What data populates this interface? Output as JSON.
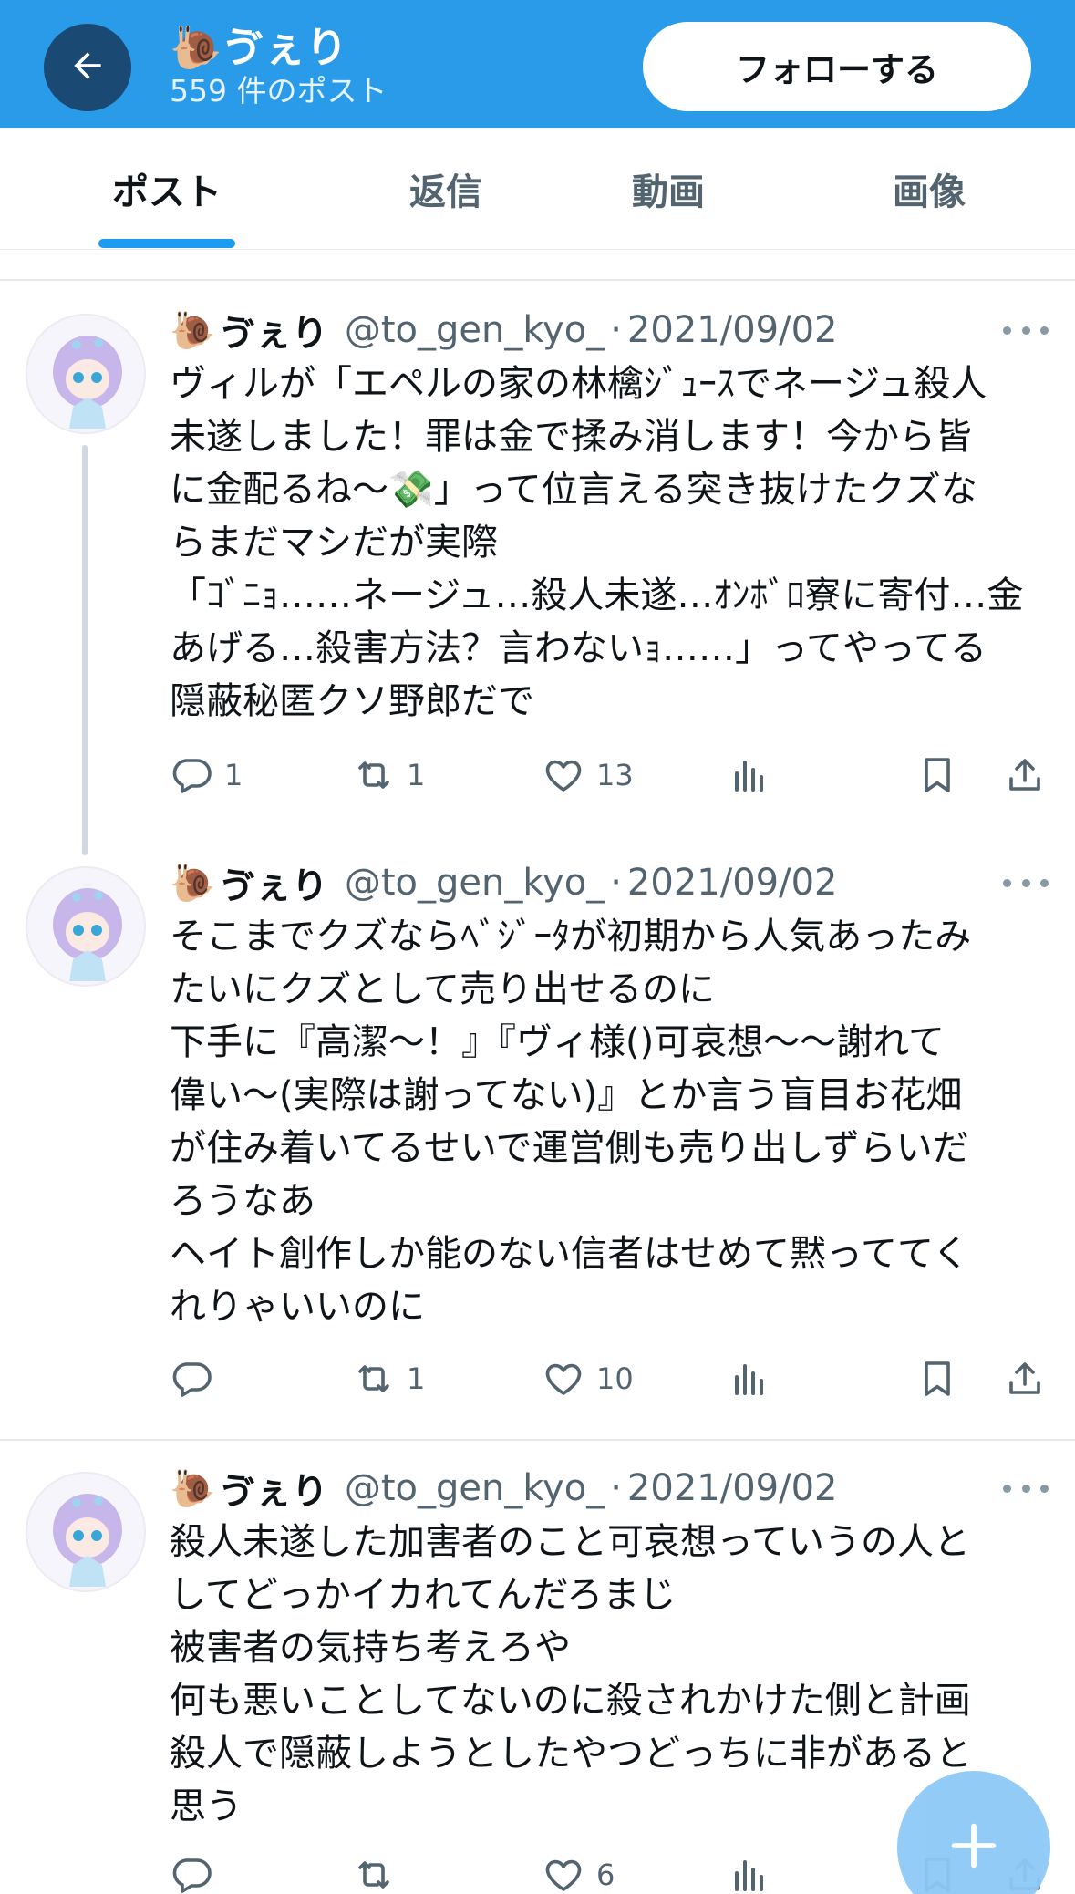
{
  "header": {
    "back_icon": "arrow-left-icon",
    "title_emoji": "🐌",
    "title": "ゔぇり",
    "subtitle": "559 件のポスト",
    "follow_label": "フォローする",
    "bg_color": "#2a9be9"
  },
  "tabs": [
    {
      "label": "ポスト",
      "active": true
    },
    {
      "label": "返信",
      "active": false
    },
    {
      "label": "動画",
      "active": false
    },
    {
      "label": "画像",
      "active": false
    }
  ],
  "accent_color": "#1d9bf0",
  "posts": [
    {
      "emoji": "🐌",
      "name": "ゔぇり",
      "handle": "@to_gen_kyo_",
      "dot": "·",
      "date": "2021/09/02",
      "text": "ヴィルが「エペルの家の林檎ｼﾞｭｰｽでネージュ殺人\n未遂しました！罪は金で揉み消します！今から皆\nに金配るね〜💸」って位言える突き抜けたクズな\nらまだマシだが実際\n「ｺﾞﾆｮ……ネージュ…殺人未遂…ｵﾝﾎﾞﾛ寮に寄付…金\nあげる…殺害方法？言わないｮ……」ってやってる\n隠蔽秘匿クソ野郎だで",
      "reply_count": "1",
      "retweet_count": "1",
      "like_count": "13"
    },
    {
      "emoji": "🐌",
      "name": "ゔぇり",
      "handle": "@to_gen_kyo_",
      "dot": "·",
      "date": "2021/09/02",
      "text": "そこまでクズならﾍﾞｼﾞｰﾀが初期から人気あったみ\nたいにクズとして売り出せるのに\n下手に『高潔〜！』『ヴィ様()可哀想〜〜謝れて\n偉い〜(実際は謝ってない)』とか言う盲目お花畑\nが住み着いてるせいで運営側も売り出しずらいだ\nろうなあ\nヘイト創作しか能のない信者はせめて黙っててく\nれりゃいいのに",
      "reply_count": "",
      "retweet_count": "1",
      "like_count": "10"
    },
    {
      "emoji": "🐌",
      "name": "ゔぇり",
      "handle": "@to_gen_kyo_",
      "dot": "·",
      "date": "2021/09/02",
      "text": "殺人未遂した加害者のこと可哀想っていうの人と\nしてどっかイカれてんだろまじ\n被害者の気持ち考えろや\n何も悪いことしてないのに殺されかけた側と計画\n殺人で隠蔽しようとしたやつどっちに非があると\n思う",
      "reply_count": "",
      "retweet_count": "",
      "like_count": "6"
    }
  ],
  "icons": {
    "reply": "reply-icon",
    "retweet": "retweet-icon",
    "like": "heart-icon",
    "views": "views-icon",
    "bookmark": "bookmark-icon",
    "share": "share-icon",
    "more": "more-icon",
    "fab": "plus-icon"
  }
}
